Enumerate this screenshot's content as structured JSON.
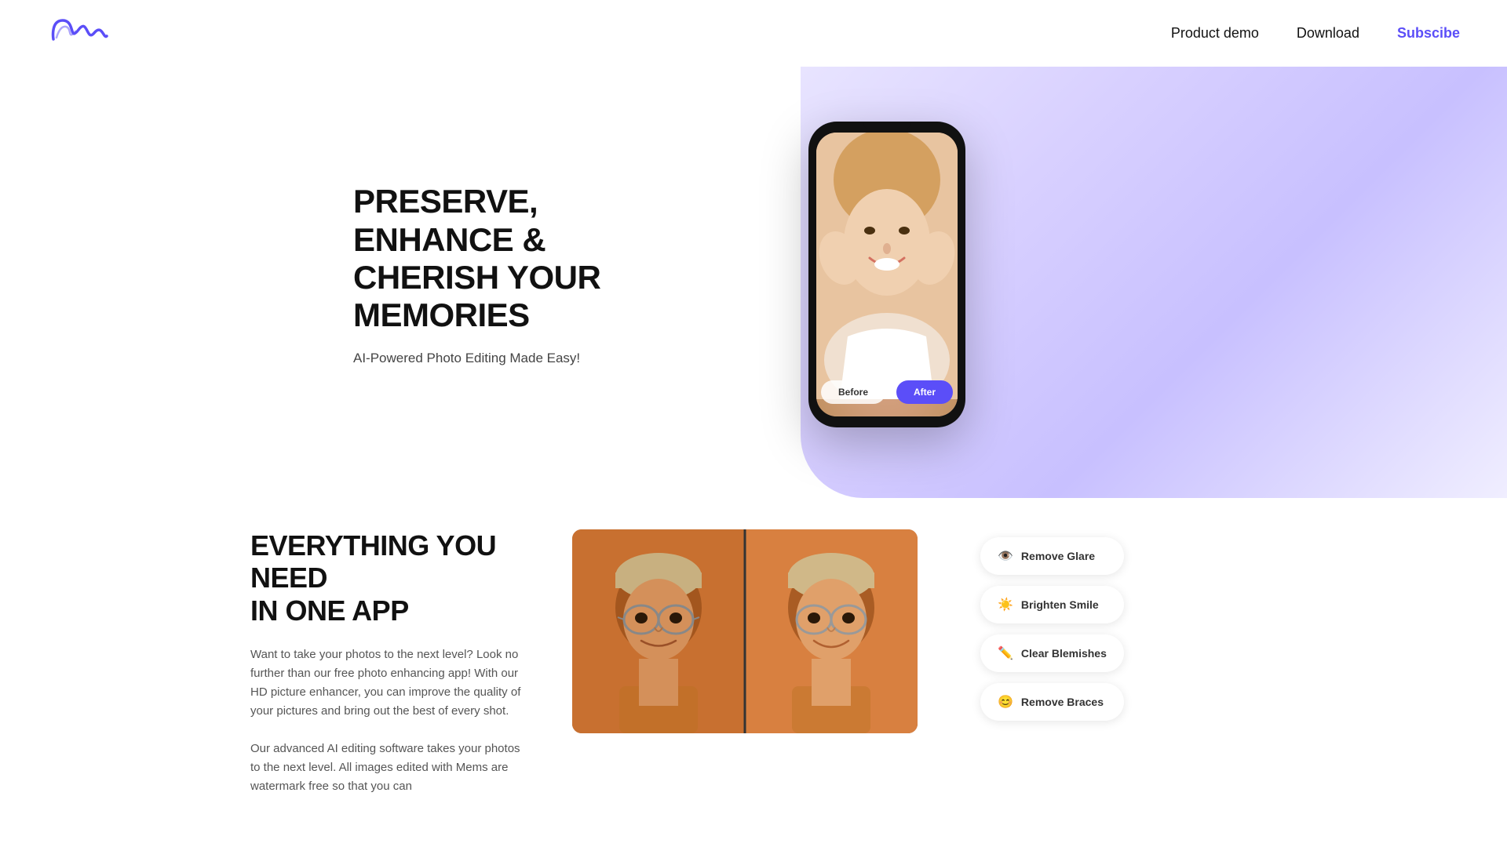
{
  "header": {
    "logo_alt": "Mems Logo",
    "nav": {
      "product_demo": "Product demo",
      "download": "Download",
      "subscribe": "Subscibe"
    }
  },
  "hero": {
    "headline_line1": "PRESERVE, ENHANCE &",
    "headline_line2": "CHERISH YOUR MEMORIES",
    "subtitle": "AI-Powered Photo Editing Made Easy!",
    "phone": {
      "btn_before": "Before",
      "btn_after": "After"
    }
  },
  "section2": {
    "headline_line1": "EVERYTHING YOU NEED",
    "headline_line2": "IN ONE APP",
    "paragraph1": "Want to take your photos to the next level? Look no further than our free photo enhancing app! With our HD picture enhancer, you can improve the quality of your pictures and bring out the best of every shot.",
    "paragraph2": "Our advanced AI editing software takes your photos to the next level. All images edited with Mems are watermark free so that you can",
    "features": [
      {
        "id": "remove-glare",
        "icon": "👁️",
        "label": "Remove Glare"
      },
      {
        "id": "brighten-smile",
        "icon": "☀️",
        "label": "Brighten Smile"
      },
      {
        "id": "clear-blemishes",
        "icon": "✏️",
        "label": "Clear Blemishes"
      },
      {
        "id": "remove-braces",
        "icon": "😊",
        "label": "Remove Braces"
      }
    ]
  },
  "colors": {
    "accent": "#5b4ef8",
    "bg_gradient_start": "#e8e4ff",
    "bg_gradient_end": "#c8c0ff"
  }
}
